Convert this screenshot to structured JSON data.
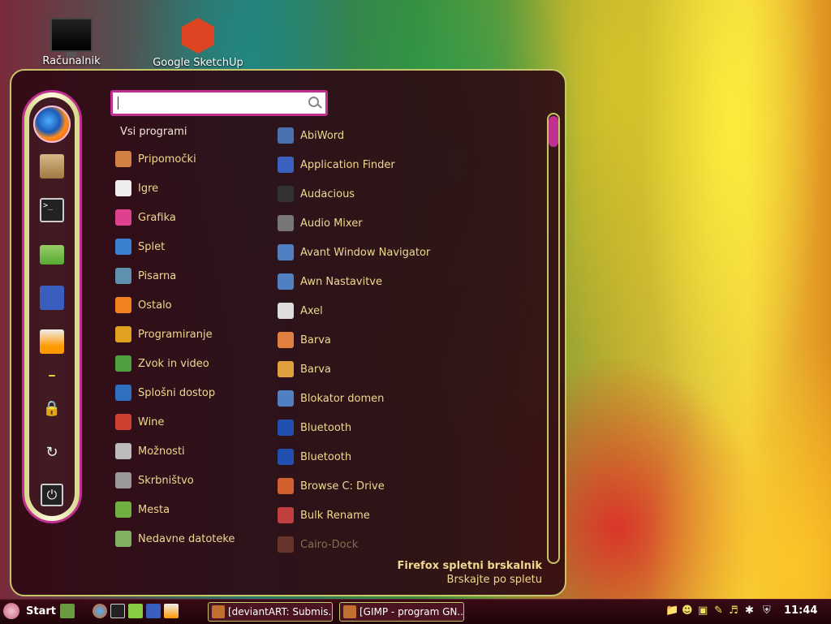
{
  "desktop": {
    "icons": [
      {
        "label": "Računalnik",
        "icon": "computer-icon"
      },
      {
        "label": "Google SketchUp",
        "icon": "sketchup-icon"
      }
    ]
  },
  "menu": {
    "search": {
      "placeholder": ""
    },
    "all_programs_label": "Vsi programi",
    "favorites": [
      "firefox-icon",
      "package-manager-icon",
      "terminal-icon",
      "file-manager-icon",
      "weather-icon",
      "media-player-icon"
    ],
    "system_buttons": [
      "lock-icon",
      "logout-icon",
      "power-icon"
    ],
    "categories": [
      {
        "label": "Pripomočki",
        "icon": "accessories-icon",
        "color": "#d08040"
      },
      {
        "label": "Igre",
        "icon": "games-icon",
        "color": "#eeeeee"
      },
      {
        "label": "Grafika",
        "icon": "graphics-icon",
        "color": "#e04090"
      },
      {
        "label": "Splet",
        "icon": "internet-icon",
        "color": "#3a80d0"
      },
      {
        "label": "Pisarna",
        "icon": "office-icon",
        "color": "#6090b0"
      },
      {
        "label": "Ostalo",
        "icon": "other-icon",
        "color": "#f08020"
      },
      {
        "label": "Programiranje",
        "icon": "programming-icon",
        "color": "#e0a020"
      },
      {
        "label": "Zvok in video",
        "icon": "multimedia-icon",
        "color": "#50a040"
      },
      {
        "label": "Splošni dostop",
        "icon": "accessibility-icon",
        "color": "#3070c0"
      },
      {
        "label": "Wine",
        "icon": "wine-icon",
        "color": "#d04030"
      },
      {
        "label": "Možnosti",
        "icon": "preferences-icon",
        "color": "#bbbbbb"
      },
      {
        "label": "Skrbništvo",
        "icon": "administration-icon",
        "color": "#999999"
      },
      {
        "label": "Mesta",
        "icon": "places-icon",
        "color": "#70b040"
      },
      {
        "label": "Nedavne datoteke",
        "icon": "recent-files-icon",
        "color": "#80b060"
      }
    ],
    "apps": [
      {
        "label": "AbiWord",
        "icon": "abiword-icon",
        "color": "#4a70b0"
      },
      {
        "label": "Application Finder",
        "icon": "app-finder-icon",
        "color": "#3a60c0"
      },
      {
        "label": "Audacious",
        "icon": "audacious-icon",
        "color": "#333333"
      },
      {
        "label": "Audio Mixer",
        "icon": "audio-mixer-icon",
        "color": "#777777"
      },
      {
        "label": "Avant Window Navigator",
        "icon": "awn-icon",
        "color": "#5080c0"
      },
      {
        "label": "Awn Nastavitve",
        "icon": "awn-settings-icon",
        "color": "#5080c0"
      },
      {
        "label": "Axel",
        "icon": "axel-icon",
        "color": "#dddddd"
      },
      {
        "label": "Barva",
        "icon": "color-icon",
        "color": "#e08040"
      },
      {
        "label": "Barva",
        "icon": "color-icon-2",
        "color": "#e0a040"
      },
      {
        "label": "Blokator domen",
        "icon": "domain-blocker-icon",
        "color": "#5080c0"
      },
      {
        "label": "Bluetooth",
        "icon": "bluetooth-icon",
        "color": "#2050b0"
      },
      {
        "label": "Bluetooth",
        "icon": "bluetooth-icon-2",
        "color": "#2050b0"
      },
      {
        "label": "Browse C: Drive",
        "icon": "wine-drive-icon",
        "color": "#d06030"
      },
      {
        "label": "Bulk Rename",
        "icon": "bulk-rename-icon",
        "color": "#c04040"
      },
      {
        "label": "Cairo-Dock",
        "icon": "cairo-dock-icon",
        "color": "#b06040"
      }
    ],
    "info": {
      "title": "Firefox spletni brskalnik",
      "description": "Brskajte po spletu"
    }
  },
  "taskbar": {
    "start_label": "Start",
    "launchers": [
      "desktop-icon",
      "firefox-icon",
      "terminal-icon",
      "folder-icon",
      "weather-icon",
      "media-icon"
    ],
    "tasks": [
      {
        "label": "[deviantART: Submis..."
      },
      {
        "label": "[GIMP - program GN..."
      }
    ],
    "tray": [
      "folder-tray-icon",
      "user-icon",
      "clipboard-icon",
      "brush-icon",
      "volume-icon",
      "bluetooth-tray-icon",
      "shield-icon"
    ],
    "clock": "11:44"
  }
}
